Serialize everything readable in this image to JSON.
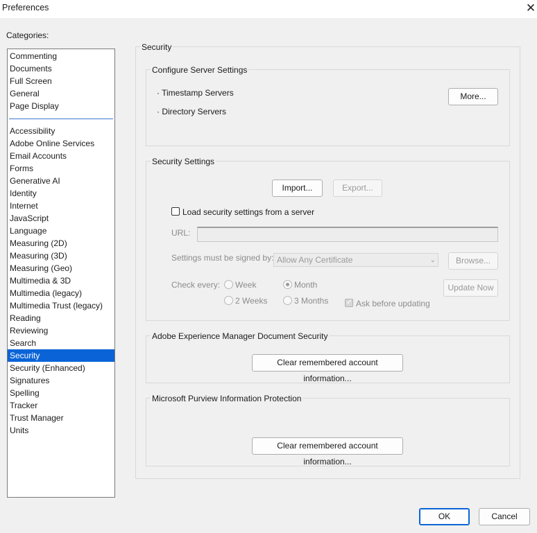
{
  "window": {
    "title": "Preferences",
    "close_glyph": "✕"
  },
  "categories": {
    "label": "Categories:",
    "group1": [
      "Commenting",
      "Documents",
      "Full Screen",
      "General",
      "Page Display"
    ],
    "group2": [
      "Accessibility",
      "Adobe Online Services",
      "Email Accounts",
      "Forms",
      "Generative AI",
      "Identity",
      "Internet",
      "JavaScript",
      "Language",
      "Measuring (2D)",
      "Measuring (3D)",
      "Measuring (Geo)",
      "Multimedia & 3D",
      "Multimedia (legacy)",
      "Multimedia Trust (legacy)",
      "Reading",
      "Reviewing",
      "Search",
      "Security",
      "Security (Enhanced)",
      "Signatures",
      "Spelling",
      "Tracker",
      "Trust Manager",
      "Units"
    ],
    "selected": "Security"
  },
  "panel": {
    "title": "Security",
    "server_settings": {
      "title": "Configure Server Settings",
      "items": [
        "· Timestamp Servers",
        "· Directory Servers"
      ],
      "more_button": "More..."
    },
    "security_settings": {
      "title": "Security Settings",
      "import_button": "Import...",
      "export_button": "Export...",
      "load_label": "Load security settings from a server",
      "load_checked": false,
      "url_label": "URL:",
      "url_value": "",
      "signed_label": "Settings must be signed by:",
      "signed_value": "Allow Any Certificate",
      "browse_button": "Browse...",
      "check_label": "Check every:",
      "options": [
        "Week",
        "Month",
        "2 Weeks",
        "3 Months"
      ],
      "selected_option": "Month",
      "update_button": "Update Now",
      "ask_label": "Ask before updating",
      "ask_checked": true
    },
    "aem": {
      "title": "Adobe Experience Manager Document Security",
      "clear_button": "Clear remembered account information..."
    },
    "purview": {
      "title": "Microsoft Purview Information Protection",
      "clear_button": "Clear remembered account information..."
    }
  },
  "footer": {
    "ok": "OK",
    "cancel": "Cancel"
  }
}
